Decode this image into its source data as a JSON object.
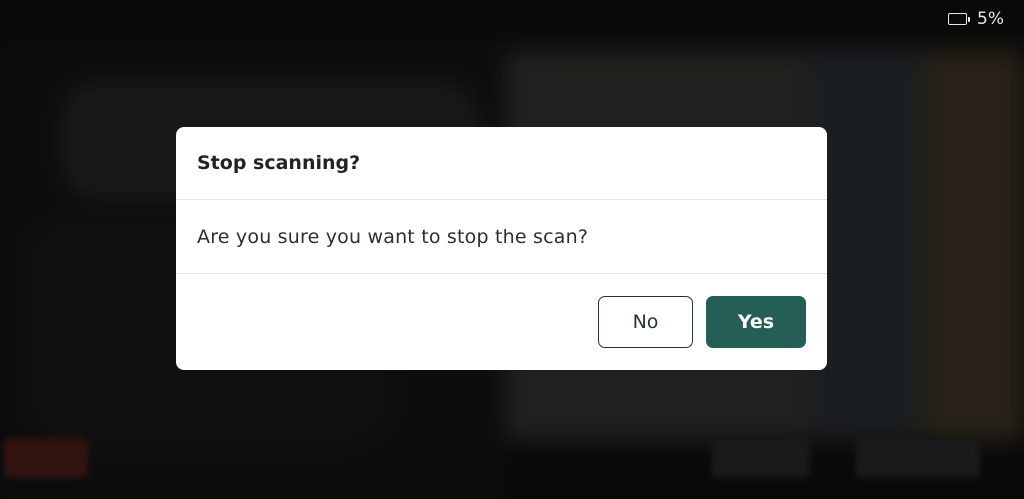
{
  "status_bar": {
    "battery_level": "5%",
    "battery_icon": "battery-low-icon"
  },
  "dialog": {
    "title": "Stop scanning?",
    "message": "Are you sure you want to stop the scan?",
    "buttons": {
      "no_label": "No",
      "yes_label": "Yes"
    }
  },
  "colors": {
    "primary": "#255e54",
    "outline": "#24343c",
    "dialog_background": "#ffffff",
    "background_dim": "#141414"
  }
}
